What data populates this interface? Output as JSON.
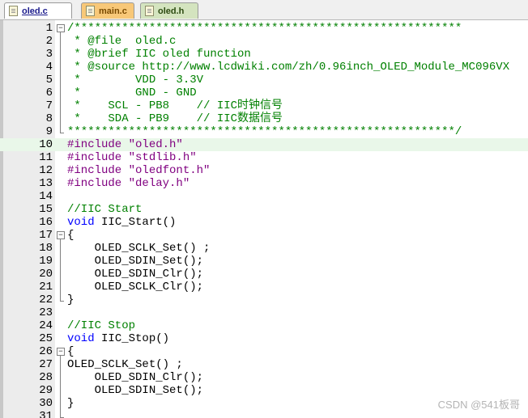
{
  "tabs": [
    {
      "label": "oled.c",
      "active": true
    },
    {
      "label": "main.c",
      "active": false
    },
    {
      "label": "oled.h",
      "active": false
    }
  ],
  "editor": {
    "current_line": 10,
    "lines": [
      {
        "n": "1",
        "text": "/*********************************************************"
      },
      {
        "n": "2",
        "text": " * @file  oled.c"
      },
      {
        "n": "3",
        "text": " * @brief IIC oled function"
      },
      {
        "n": "4",
        "text": " * @source http://www.lcdwiki.com/zh/0.96inch_OLED_Module_MC096VX"
      },
      {
        "n": "5",
        "text": " *        VDD - 3.3V"
      },
      {
        "n": "6",
        "text": " *        GND - GND"
      },
      {
        "n": "7",
        "text": " *    SCL - PB8    // IIC时钟信号"
      },
      {
        "n": "8",
        "text": " *    SDA - PB9    // IIC数据信号"
      },
      {
        "n": "9",
        "text": "*********************************************************/"
      },
      {
        "n": "10",
        "pre": "#include ",
        "str": "\"oled.h\""
      },
      {
        "n": "11",
        "pre": "#include ",
        "str": "\"stdlib.h\""
      },
      {
        "n": "12",
        "pre": "#include ",
        "str": "\"oledfont.h\""
      },
      {
        "n": "13",
        "pre": "#include ",
        "str": "\"delay.h\""
      },
      {
        "n": "14",
        "text": ""
      },
      {
        "n": "15",
        "text": "//IIC Start"
      },
      {
        "n": "16",
        "kw": "void",
        "rest": " IIC_Start()"
      },
      {
        "n": "17",
        "text": "{"
      },
      {
        "n": "18",
        "text": "    OLED_SCLK_Set() ;"
      },
      {
        "n": "19",
        "text": "    OLED_SDIN_Set();"
      },
      {
        "n": "20",
        "text": "    OLED_SDIN_Clr();"
      },
      {
        "n": "21",
        "text": "    OLED_SCLK_Clr();"
      },
      {
        "n": "22",
        "text": "}"
      },
      {
        "n": "23",
        "text": ""
      },
      {
        "n": "24",
        "text": "//IIC Stop"
      },
      {
        "n": "25",
        "kw": "void",
        "rest": " IIC_Stop()"
      },
      {
        "n": "26",
        "text": "{"
      },
      {
        "n": "27",
        "text": "OLED_SCLK_Set() ;"
      },
      {
        "n": "28",
        "text": "    OLED_SDIN_Clr();"
      },
      {
        "n": "29",
        "text": "    OLED_SDIN_Set();"
      },
      {
        "n": "30",
        "text": "}"
      },
      {
        "n": "31",
        "text": ""
      }
    ]
  },
  "watermark": "CSDN @541板哥"
}
